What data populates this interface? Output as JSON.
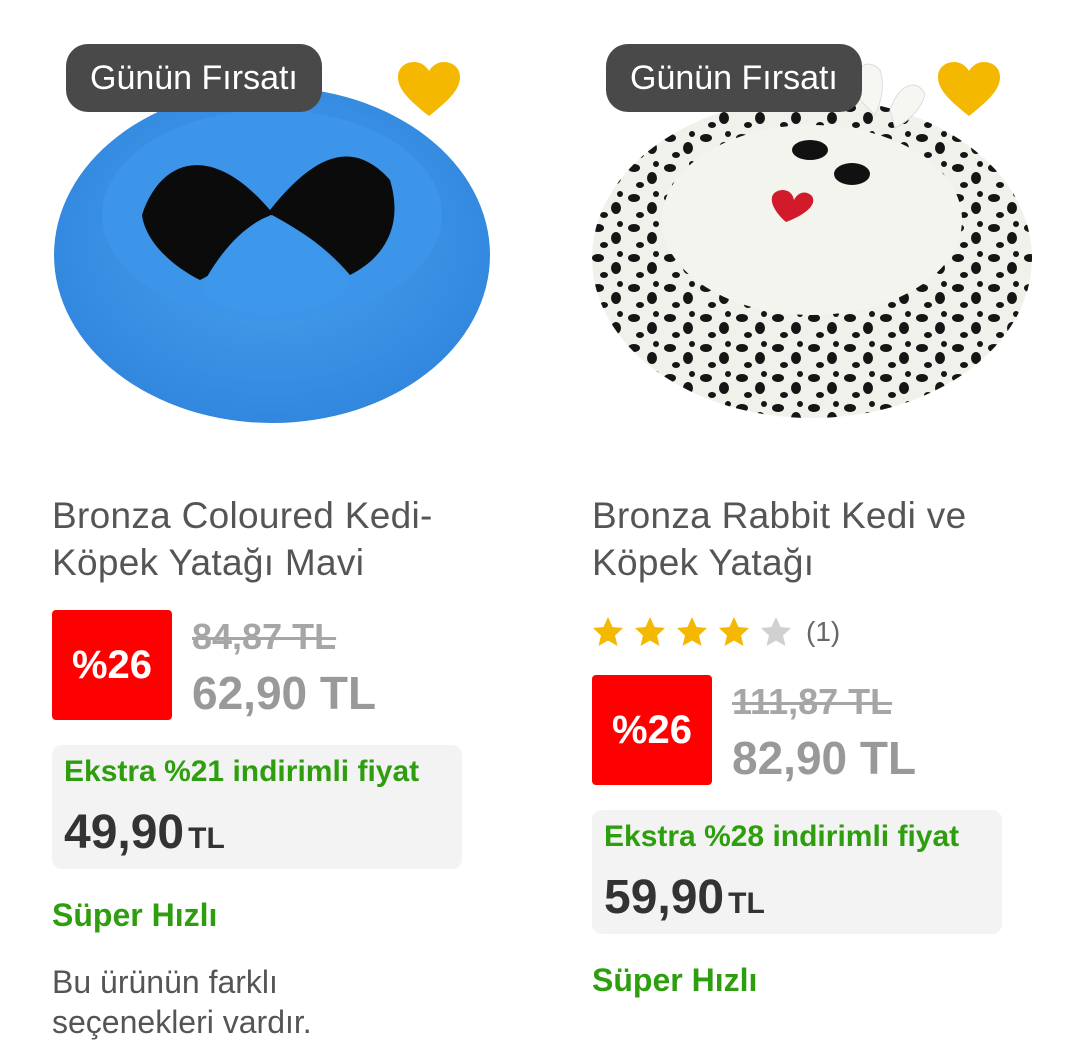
{
  "products": [
    {
      "badge": "Günün Fırsatı",
      "title": "Bronza Coloured Kedi-Köpek Yatağı Mavi",
      "discount": "%26",
      "old_price": "84,87 TL",
      "new_price": "62,90 TL",
      "extra_label": "Ekstra %21 indirimli fiyat",
      "extra_price": "49,90",
      "extra_currency": "TL",
      "shipping": "Süper Hızlı",
      "variants_note": "Bu ürünün farklı seçenekleri vardır."
    },
    {
      "badge": "Günün Fırsatı",
      "title": "Bronza Rabbit Kedi ve Köpek Yatağı",
      "rating": {
        "stars": 4,
        "max": 5,
        "count": "(1)"
      },
      "discount": "%26",
      "old_price": "111,87 TL",
      "new_price": "82,90 TL",
      "extra_label": "Ekstra %28 indirimli fiyat",
      "extra_price": "59,90",
      "extra_currency": "TL",
      "shipping": "Süper Hızlı"
    }
  ],
  "colors": {
    "badge_bg": "#494949",
    "favorite": "#f5b800",
    "discount_bg": "#ff0000",
    "green": "#2e9e0f",
    "star_on": "#f5b800",
    "star_off": "#d0d0d0"
  },
  "icons": {
    "favorite": "heart-icon",
    "rating": "star-icon"
  }
}
